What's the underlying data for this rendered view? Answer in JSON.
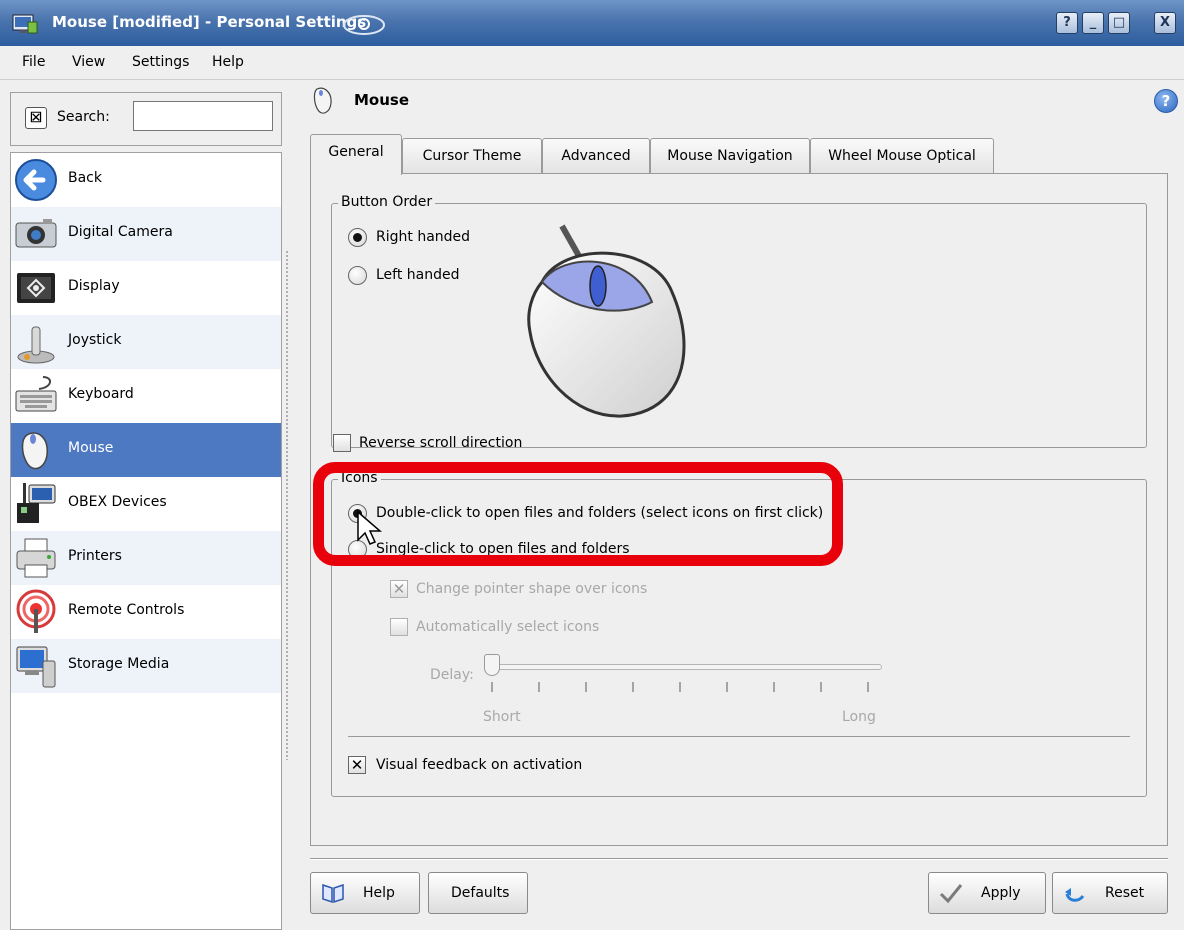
{
  "window": {
    "title": "Mouse [modified] - Personal Settings",
    "controls": {
      "help": "?",
      "minimize": "_",
      "maximize": "□",
      "close": "X"
    }
  },
  "menu": [
    "File",
    "View",
    "Settings",
    "Help"
  ],
  "sidebar": {
    "search_label": "Search:",
    "search_value": "",
    "items": [
      {
        "label": "Back",
        "icon": "back-arrow-icon"
      },
      {
        "label": "Digital Camera",
        "icon": "camera-icon"
      },
      {
        "label": "Display",
        "icon": "display-icon"
      },
      {
        "label": "Joystick",
        "icon": "joystick-icon"
      },
      {
        "label": "Keyboard",
        "icon": "keyboard-icon"
      },
      {
        "label": "Mouse",
        "icon": "mouse-icon",
        "selected": true
      },
      {
        "label": "OBEX Devices",
        "icon": "obex-icon"
      },
      {
        "label": "Printers",
        "icon": "printer-icon"
      },
      {
        "label": "Remote Controls",
        "icon": "remote-icon"
      },
      {
        "label": "Storage Media",
        "icon": "storage-icon"
      }
    ]
  },
  "main": {
    "title": "Mouse",
    "help_glyph": "?",
    "tabs": [
      "General",
      "Cursor Theme",
      "Advanced",
      "Mouse Navigation",
      "Wheel Mouse Optical"
    ],
    "active_tab": "General",
    "button_order": {
      "title": "Button Order",
      "right_handed": "Right handed",
      "left_handed": "Left handed",
      "selected": "right"
    },
    "reverse_scroll": {
      "label": "Reverse scroll direction",
      "checked": false
    },
    "icons_group": {
      "title": "Icons",
      "double_click": "Double-click to open files and folders (select icons on first click)",
      "single_click": "Single-click to open files and folders",
      "selected": "double",
      "change_pointer": {
        "label": "Change pointer shape over icons",
        "checked": true,
        "enabled": false
      },
      "auto_select": {
        "label": "Automatically select icons",
        "checked": false,
        "enabled": false
      },
      "delay_label": "Delay:",
      "short_label": "Short",
      "long_label": "Long",
      "delay_value_fraction": 0.0,
      "visual_feedback": {
        "label": "Visual feedback on activation",
        "checked": true
      }
    },
    "buttons": {
      "help": "Help",
      "defaults": "Defaults",
      "apply": "Apply",
      "reset": "Reset"
    }
  },
  "colors": {
    "selection": "#4d78c2",
    "highlight_annotation": "#e8000b",
    "titlebar": "#4a74ad"
  }
}
